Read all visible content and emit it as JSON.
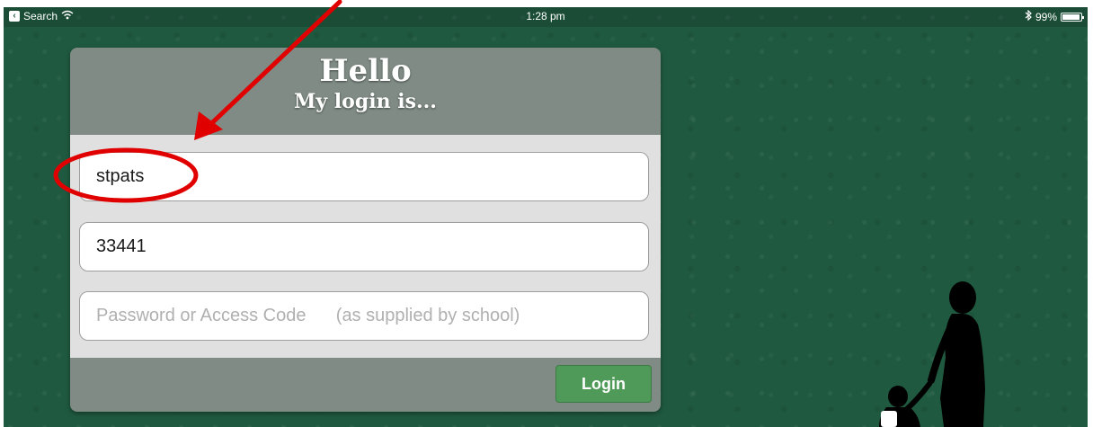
{
  "status_bar": {
    "back_app": "Search",
    "back_icon": "back-box-icon",
    "wifi_icon": "wifi-icon",
    "time": "1:28 pm",
    "bluetooth_icon": "bluetooth-icon",
    "battery_percent": "99%",
    "battery_level": 0.99
  },
  "header": {
    "title": "Hello",
    "subtitle": "My login is..."
  },
  "form": {
    "school_field_value": "stpats",
    "id_field_value": "33441",
    "password_placeholder": "Password or Access Code      (as supplied by school)"
  },
  "footer": {
    "login_label": "Login"
  },
  "colors": {
    "background": "#1f5a40",
    "card_header": "#7f8b84",
    "card_body": "#e0e0e0",
    "login_button": "#4f9a58",
    "annotation": "#e00000"
  }
}
